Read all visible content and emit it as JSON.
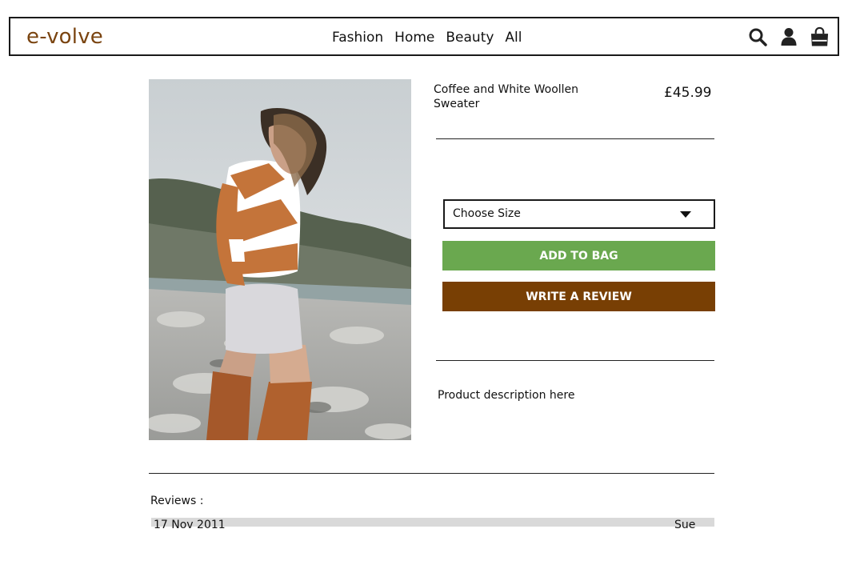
{
  "header": {
    "logo": "e-volve",
    "nav": [
      "Fashion",
      "Home",
      "Beauty",
      "All"
    ],
    "icons": [
      "search-icon",
      "user-icon",
      "shopping-bag-icon"
    ]
  },
  "product": {
    "title": "Coffee and White Woollen Sweater",
    "price": "£45.99",
    "size_select_label": "Choose Size",
    "add_to_bag_label": "ADD TO BAG",
    "write_review_label": "WRITE A REVIEW",
    "description": "Product description here"
  },
  "reviews": {
    "label": "Reviews :",
    "items": [
      {
        "date": "17 Nov 2011",
        "author": "Sue"
      }
    ]
  },
  "colors": {
    "brand": "#7a4410",
    "add_to_bag": "#6aa84f",
    "write_review": "#783f04",
    "review_row": "#d9d9d9"
  }
}
